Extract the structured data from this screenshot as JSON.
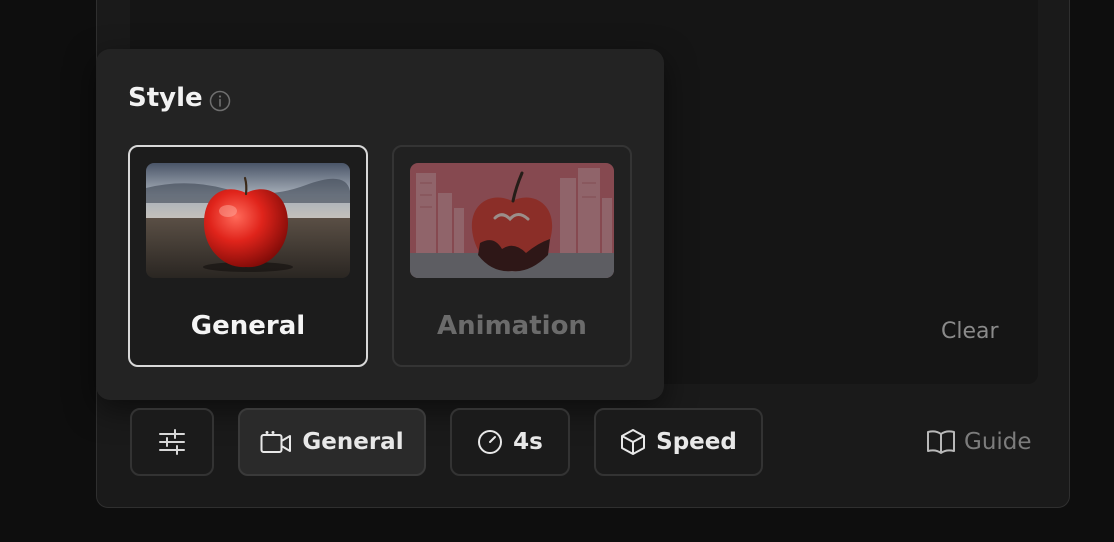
{
  "style_popup": {
    "title": "Style",
    "info_icon": "info-icon",
    "options": [
      {
        "label": "General",
        "selected": true,
        "thumbnail": "realistic apple in field"
      },
      {
        "label": "Animation",
        "selected": false,
        "thumbnail": "cartoon apple with city backdrop"
      }
    ]
  },
  "prompt": {
    "clear_label": "Clear"
  },
  "toolbar": {
    "settings_icon": "sliders-icon",
    "mode_icon": "video-camera-icon",
    "mode_label": "General",
    "duration_icon": "timer-icon",
    "duration_label": "4s",
    "speed_icon": "cube-icon",
    "speed_label": "Speed",
    "guide_icon": "book-icon",
    "guide_label": "Guide"
  },
  "colors": {
    "background": "#0e0e0e",
    "panel": "#1a1a1a",
    "popup": "#232323",
    "selected_border": "#d8d8d8",
    "muted_text": "#7c7c7c"
  }
}
